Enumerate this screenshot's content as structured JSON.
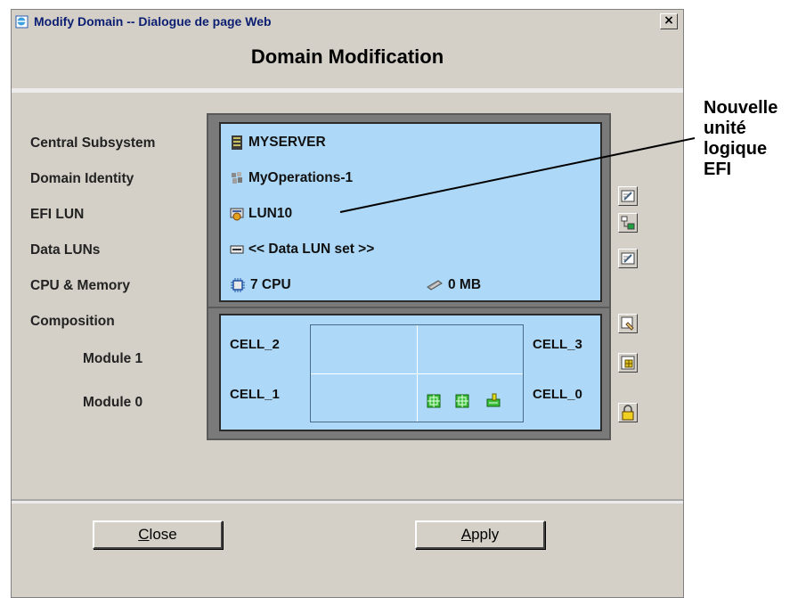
{
  "window": {
    "title": "Modify Domain -- Dialogue de page Web",
    "close_glyph": "×"
  },
  "heading": "Domain Modification",
  "labels": {
    "central_subsystem": "Central Subsystem",
    "domain_identity": "Domain Identity",
    "efi_lun": "EFI LUN",
    "data_luns": "Data LUNs",
    "cpu_memory": "CPU & Memory",
    "composition": "Composition",
    "module_1": "Module 1",
    "module_0": "Module 0"
  },
  "values": {
    "central_subsystem": "MYSERVER",
    "domain_identity": "MyOperations-1",
    "efi_lun": "LUN10",
    "data_luns": "<< Data LUN set >>",
    "cpu": "7 CPU",
    "memory": "0 MB"
  },
  "cells": {
    "cell_2": "CELL_2",
    "cell_3": "CELL_3",
    "cell_1": "CELL_1",
    "cell_0": "CELL_0"
  },
  "buttons": {
    "close_mnemonic": "C",
    "close_rest": "lose",
    "apply_mnemonic": "A",
    "apply_rest": "pply"
  },
  "annotation": {
    "line1": "Nouvelle",
    "line2": "unité",
    "line3": "logique",
    "line4": "EFI"
  },
  "icons": {
    "app": "ie-page-icon",
    "server": "server-icon",
    "domain": "domain-icon",
    "lun": "lun-disk-icon",
    "data_lun": "data-lun-icon",
    "cpu": "cpu-chip-icon",
    "memory": "memory-module-icon",
    "cell_cpu": "cell-cpu-icon",
    "cell_io": "cell-io-icon"
  },
  "colors": {
    "panel_bg": "#d4d0c8",
    "info_bg": "#add8f7",
    "frame": "#7a7a7a",
    "title_text": "#0c1e72"
  }
}
